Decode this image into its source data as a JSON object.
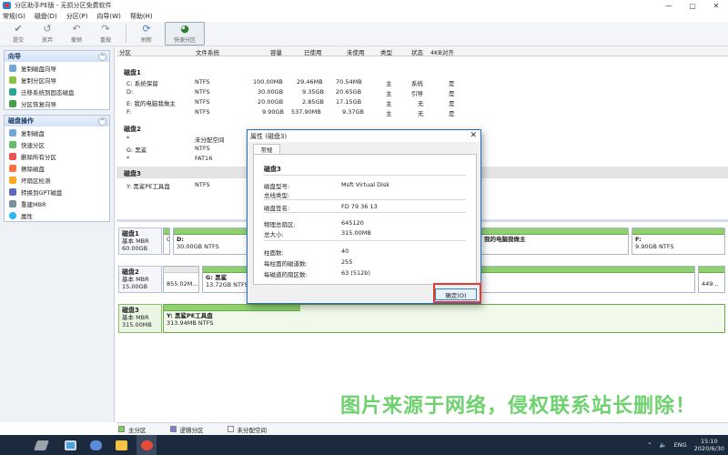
{
  "window": {
    "title": "分区助手PE版 - 无损分区免费软件",
    "controls": [
      "—",
      "▢",
      "✕"
    ]
  },
  "menu": [
    "常规(G)",
    "磁盘(D)",
    "分区(P)",
    "向导(W)",
    "帮助(H)"
  ],
  "toolbar": [
    {
      "label": "提交",
      "icon": "check-icon"
    },
    {
      "label": "放弃",
      "icon": "discard-icon"
    },
    {
      "label": "撤销",
      "icon": "undo-icon"
    },
    {
      "label": "重做",
      "icon": "redo-icon"
    },
    {
      "label": "刷新",
      "icon": "refresh-icon"
    },
    {
      "label": "快速分区",
      "icon": "quick-partition-icon"
    }
  ],
  "sidebar": {
    "wizard": {
      "title": "向导",
      "items": [
        "复制磁盘向导",
        "复制分区向导",
        "迁移系统到固态磁盘",
        "分区恢复向导"
      ]
    },
    "disk_ops": {
      "title": "磁盘操作",
      "items": [
        "复制磁盘",
        "快速分区",
        "删除所有分区",
        "擦除磁盘",
        "坏扇区检测",
        "转换到GPT磁盘",
        "重建MBR",
        "属性"
      ]
    }
  },
  "table": {
    "headers": [
      "分区",
      "文件系统",
      "容量",
      "已使用",
      "未使用",
      "类型",
      "状态",
      "4KB对齐"
    ],
    "disk1_label": "磁盘1",
    "disk1_rows": [
      [
        "C: 系统保留",
        "NTFS",
        "100.00MB",
        "29.46MB",
        "70.54MB",
        "主",
        "系统",
        "是"
      ],
      [
        "D:",
        "NTFS",
        "30.00GB",
        "9.35GB",
        "20.65GB",
        "主",
        "引导",
        "是"
      ],
      [
        "E: 我的电脑我做主",
        "NTFS",
        "20.00GB",
        "2.85GB",
        "17.15GB",
        "主",
        "无",
        "是"
      ],
      [
        "F:",
        "NTFS",
        "9.90GB",
        "537.90MB",
        "9.37GB",
        "主",
        "无",
        "是"
      ]
    ],
    "disk2_label": "磁盘2",
    "disk2_rows": [
      [
        "*",
        "未分配空间"
      ],
      [
        "G: 黑鲨",
        "NTFS"
      ],
      [
        "*",
        "FAT16"
      ]
    ],
    "disk3_label": "磁盘3",
    "disk3_rows": [
      [
        "Y: 黑鲨PE工具盘",
        "NTFS"
      ]
    ]
  },
  "diskmap": {
    "disk1": {
      "name": "磁盘1",
      "type": "基本 MBR",
      "size": "60.00GB",
      "parts": [
        {
          "name": "C",
          "fs": "",
          "size": ""
        },
        {
          "name": "D:",
          "fs": "30.00GB NTFS",
          "size": ""
        },
        {
          "name": "我的电脑我做主",
          "fs": "",
          "size": ""
        },
        {
          "name": "F:",
          "fs": "9.90GB NTFS",
          "size": ""
        }
      ]
    },
    "disk2": {
      "name": "磁盘2",
      "type": "基本 MBR",
      "size": "15.00GB",
      "parts": [
        {
          "name": "",
          "fs": "855.02M..."
        },
        {
          "name": "G: 黑鲨",
          "fs": "13.72GB NTFS"
        },
        {
          "name": "",
          "fs": "449..."
        }
      ]
    },
    "disk3": {
      "name": "磁盘3",
      "type": "基本 MBR",
      "size": "315.00MB",
      "parts": [
        {
          "name": "Y: 黑鲨PE工具盘",
          "fs": "313.94MB NTFS"
        }
      ]
    }
  },
  "dialog": {
    "title": "属性 (磁盘3)",
    "tab": "常规",
    "heading": "磁盘3",
    "fields": [
      {
        "k": "磁盘型号:",
        "v": "Msft    Virtual Disk"
      },
      {
        "k": "总线类型:",
        "v": ""
      },
      {
        "k": "磁盘签名:",
        "v": "FD 79 36 13"
      },
      {
        "k": "物理总扇区:",
        "v": "645120"
      },
      {
        "k": "总大小:",
        "v": "315.00MB"
      },
      {
        "k": "柱面数:",
        "v": "40"
      },
      {
        "k": "每柱面的磁道数:",
        "v": "255"
      },
      {
        "k": "每磁道的扇区数:",
        "v": "63 (512b)"
      }
    ],
    "ok_label": "确定(O)"
  },
  "watermark": "图片来源于网络，侵权联系站长删除！",
  "legend": [
    {
      "label": "主分区",
      "color": "#7ecf5a"
    },
    {
      "label": "逻辑分区",
      "color": "#7b7ed6"
    },
    {
      "label": "未分配空间",
      "color": "#ffffff"
    }
  ],
  "taskbar": {
    "lang": "ENG",
    "time": "15:10",
    "date": "2020/6/30"
  }
}
